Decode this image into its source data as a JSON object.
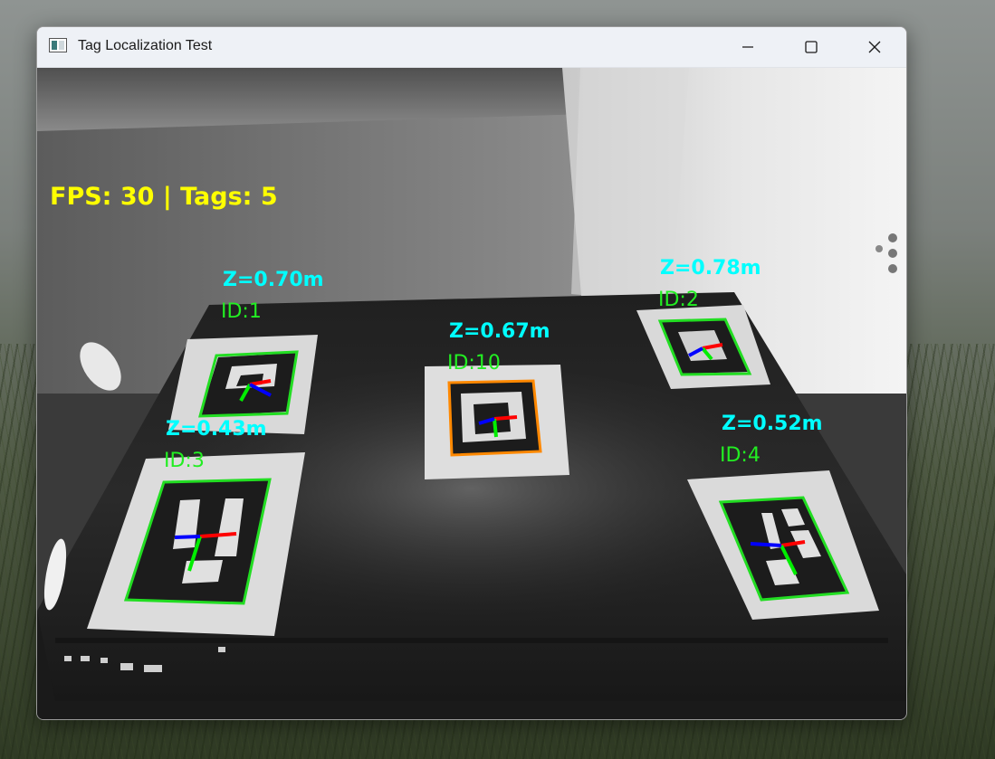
{
  "window": {
    "title": "Tag Localization Test"
  },
  "icons": {
    "app": "window-app-icon",
    "minimize": "minimize-icon",
    "maximize": "maximize-icon",
    "close": "close-icon"
  },
  "hud": {
    "text": "FPS: 30 | Tags: 5"
  },
  "tags": [
    {
      "id_label": "ID:1",
      "z_label": "Z=0.70m"
    },
    {
      "id_label": "ID:2",
      "z_label": "Z=0.78m"
    },
    {
      "id_label": "ID:10",
      "z_label": "Z=0.67m"
    },
    {
      "id_label": "ID:3",
      "z_label": "Z=0.43m"
    },
    {
      "id_label": "ID:4",
      "z_label": "Z=0.52m"
    }
  ],
  "colors": {
    "hud": "#ffff00",
    "id_label": "#22ee22",
    "z_label": "#00ffff",
    "outline": "#22dd22",
    "outline_highlight": "#ff8800",
    "axis_x": "#ff0000",
    "axis_y": "#00ee00",
    "axis_z": "#0000ff"
  }
}
